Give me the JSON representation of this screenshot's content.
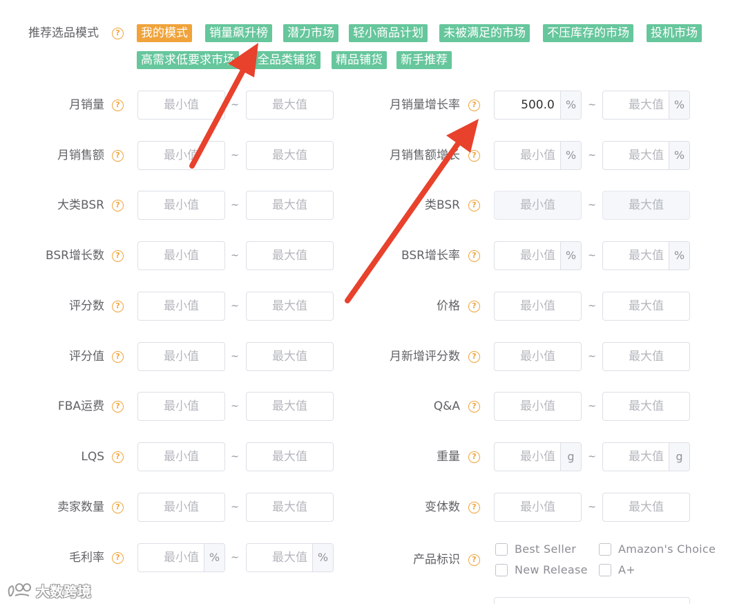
{
  "mode": {
    "label": "推荐选品模式",
    "tags": [
      {
        "label": "我的模式",
        "active": true
      },
      {
        "label": "销量飙升榜",
        "active": false
      },
      {
        "label": "潜力市场",
        "active": false
      },
      {
        "label": "轻小商品计划",
        "active": false
      },
      {
        "label": "未被满足的市场",
        "active": false
      },
      {
        "label": "不压库存的市场",
        "active": false
      },
      {
        "label": "投机市场",
        "active": false
      },
      {
        "label": "高需求低要求市场",
        "active": false
      },
      {
        "label": "全品类铺货",
        "active": false
      },
      {
        "label": "精品铺货",
        "active": false
      },
      {
        "label": "新手推荐",
        "active": false
      }
    ]
  },
  "placeholders": {
    "min": "最小值",
    "max": "最大值"
  },
  "left_fields": [
    {
      "label": "月销量",
      "suffix": ""
    },
    {
      "label": "月销售额",
      "suffix": ""
    },
    {
      "label": "大类BSR",
      "suffix": ""
    },
    {
      "label": "BSR增长数",
      "suffix": ""
    },
    {
      "label": "评分数",
      "suffix": ""
    },
    {
      "label": "评分值",
      "suffix": ""
    },
    {
      "label": "FBA运费",
      "suffix": ""
    },
    {
      "label": "LQS",
      "suffix": ""
    },
    {
      "label": "卖家数量",
      "suffix": ""
    },
    {
      "label": "毛利率",
      "suffix": "%"
    }
  ],
  "right_fields": [
    {
      "label": "月销量增长率",
      "suffix": "%",
      "min_value": "500.0"
    },
    {
      "label": "月销售额增长",
      "suffix": "%"
    },
    {
      "label": "类BSR",
      "suffix": "",
      "disabled": true
    },
    {
      "label": "BSR增长率",
      "suffix": "%"
    },
    {
      "label": "价格",
      "suffix": ""
    },
    {
      "label": "月新增评分数",
      "suffix": ""
    },
    {
      "label": "Q&A",
      "suffix": ""
    },
    {
      "label": "重量",
      "suffix": "g"
    },
    {
      "label": "变体数",
      "suffix": ""
    }
  ],
  "product_tags": {
    "label": "产品标识",
    "options": [
      "Best Seller",
      "Amazon's Choice",
      "New Release",
      "A+"
    ]
  },
  "separator": "~",
  "help_glyph": "?",
  "watermark": {
    "text": "大数跨境"
  },
  "colors": {
    "accent_orange": "#f0a33a",
    "tag_green": "#66c69c",
    "arrow_red": "#e8412c"
  }
}
